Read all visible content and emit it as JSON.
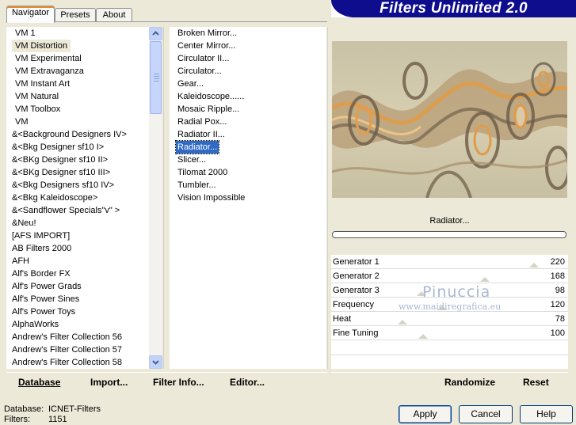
{
  "banner": {
    "title": "Filters Unlimited 2.0"
  },
  "tabs": [
    "Navigator",
    "Presets",
    "About"
  ],
  "categories": [
    "VM 1",
    "VM Distortion",
    "VM Experimental",
    "VM Extravaganza",
    "VM Instant Art",
    "VM Natural",
    "VM Toolbox",
    "VM",
    "&<Background Designers IV>",
    "&<Bkg Designer sf10 I>",
    "&<BKg Designer sf10 II>",
    "&<BKg Designer sf10 III>",
    "&<Bkg Designers sf10 IV>",
    "&<Bkg Kaleidoscope>",
    "&<Sandflower Specials\"v\" >",
    "&Neu!",
    "[AFS IMPORT]",
    "AB Filters 2000",
    "AFH",
    "Alf's Border FX",
    "Alf's Power Grads",
    "Alf's Power Sines",
    "Alf's Power Toys",
    "AlphaWorks",
    "Andrew's Filter Collection 56",
    "Andrew's Filter Collection 57",
    "Andrew's Filter Collection 58"
  ],
  "selected_category": "VM Distortion",
  "filters": [
    "Broken Mirror...",
    "Center Mirror...",
    "Circulator II...",
    "Circulator...",
    "Gear...",
    "Kaleidoscope......",
    "Mosaic Ripple...",
    "Radial Pox...",
    "Radiator II...",
    "Radiator...",
    "Slicer...",
    "Tilomat 2000",
    "Tumbler...",
    "Vision Impossible"
  ],
  "selected_filter": "Radiator...",
  "preview": {
    "filter_name": "Radiator..."
  },
  "params": [
    {
      "label": "Generator 1",
      "value": "220"
    },
    {
      "label": "Generator 2",
      "value": "168"
    },
    {
      "label": "Generator 3",
      "value": "98"
    },
    {
      "label": "Frequency",
      "value": "120"
    },
    {
      "label": "Heat",
      "value": "78"
    },
    {
      "label": "Fine Tuning",
      "value": "100"
    }
  ],
  "watermark": {
    "name": "Pinuccia",
    "url": "www.maidiregrafica.eu"
  },
  "left_bar": {
    "database": "Database",
    "import": "Import...",
    "filter_info": "Filter Info...",
    "editor": "Editor..."
  },
  "right_bar": {
    "randomize": "Randomize",
    "reset": "Reset"
  },
  "status": {
    "database_label": "Database:",
    "database_value": "ICNET-Filters",
    "filters_label": "Filters:",
    "filters_value": "1151"
  },
  "buttons": {
    "apply": "Apply",
    "cancel": "Cancel",
    "help": "Help"
  },
  "colors": {
    "banner": "#0e0d8e",
    "selection": "#316ac5",
    "dialog": "#ece9d8"
  }
}
